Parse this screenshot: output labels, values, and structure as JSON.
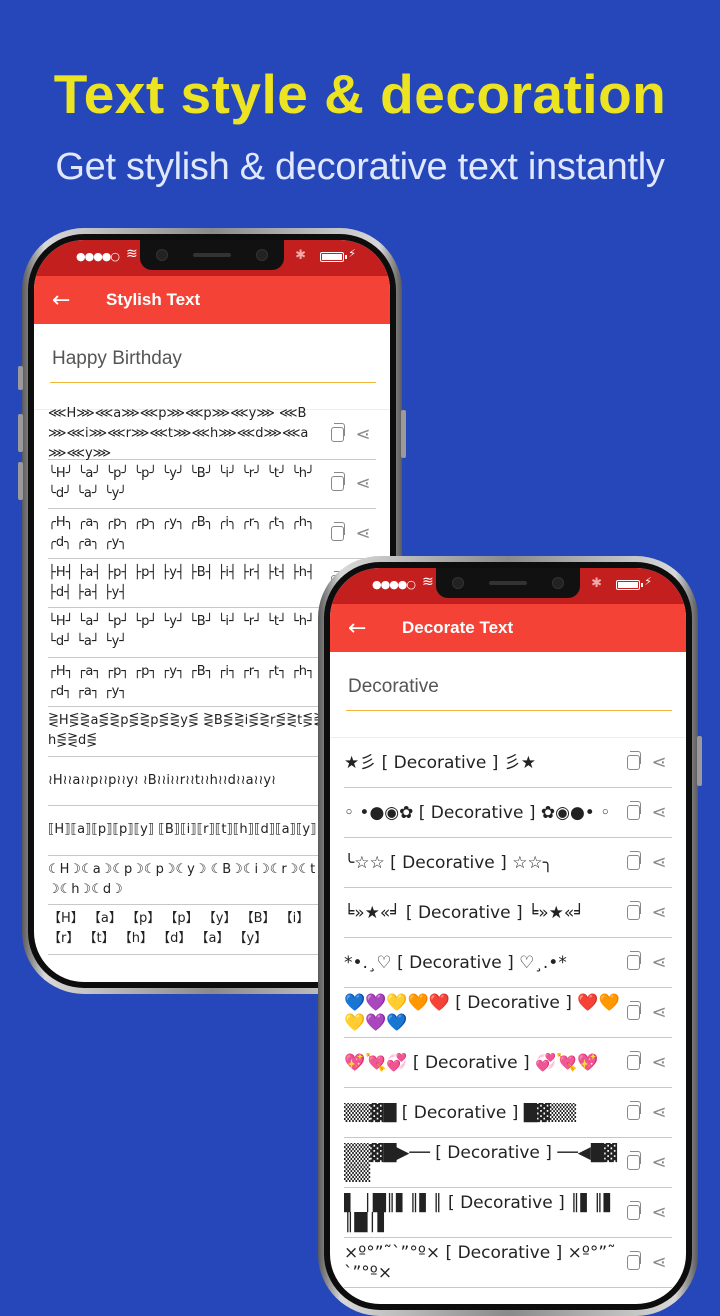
{
  "promo": {
    "headline": "Text style & decoration",
    "subheadline": "Get stylish & decorative text instantly"
  },
  "colors": {
    "background": "#2547b9",
    "headline": "#ece323",
    "appbar": "#f44336",
    "statusbar": "#c41f1f",
    "input_underline": "#f2b73a"
  },
  "status_bar": {
    "signal": "●●●●○",
    "wifi_icon": "wifi-icon",
    "bluetooth_icon": "bluetooth-icon",
    "battery_icon": "battery-icon",
    "charging_icon": "⚡"
  },
  "stylish_screen": {
    "title": "Stylish Text",
    "back_icon": "←",
    "input_value": "Happy Birthday",
    "items": [
      {
        "text": "⋘H⋙⋘a⋙⋘p⋙⋘p⋙⋘y⋙ ⋘B⋙⋘i⋙⋘r⋙⋘t⋙⋘h⋙⋘d⋙⋘a⋙⋘y⋙"
      },
      {
        "text": "╰H╯ ╰a╯ ╰p╯ ╰p╯ ╰y╯ ╰B╯ ╰i╯ ╰r╯ ╰t╯ ╰h╯ ╰d╯ ╰a╯ ╰y╯"
      },
      {
        "text": "╭H╮ ╭a╮ ╭p╮ ╭p╮ ╭y╮ ╭B╮ ╭i╮ ╭r╮ ╭t╮ ╭h╮ ╭d╮ ╭a╮ ╭y╮"
      },
      {
        "text": "├H┤ ├a┤ ├p┤ ├p┤ ├y┤ ├B┤ ├i┤ ├r┤ ├t┤ ├h┤ ├d┤ ├a┤ ├y┤"
      },
      {
        "text": "└H┘ └a┘ └p┘ └p┘ └y┘ └B┘ └i┘ └r┘ └t┘ └h┘ └d┘ └a┘ └y┘"
      },
      {
        "text": "┌H┐ ┌a┐ ┌p┐ ┌p┐ ┌y┐ ┌B┐ ┌i┐ ┌r┐ ┌t┐ ┌h┐ ┌d┐ ┌a┐ ┌y┐"
      },
      {
        "text": "⋛H⋚⋛a⋚⋛p⋚⋛p⋚⋛y⋚ ⋛B⋚⋛i⋚⋛r⋚⋛t⋚⋛h⋚⋛d⋚"
      },
      {
        "text": "≀H≀≀a≀≀p≀≀p≀≀y≀ ≀B≀≀i≀≀r≀≀t≀≀h≀≀d≀≀a≀≀y≀"
      },
      {
        "text": "⟦H⟧⟦a⟧⟦p⟧⟦p⟧⟦y⟧ ⟦B⟧⟦i⟧⟦r⟧⟦t⟧⟦h⟧⟦d⟧⟦a⟧⟦y⟧"
      },
      {
        "text": "☾H☽☾a☽☾p☽☾p☽☾y☽ ☾B☽☾i☽☾r☽☾t☽☾h☽☾d☽"
      },
      {
        "text": "【H】 【a】 【p】 【p】 【y】 【B】 【i】 【r】 【t】 【h】 【d】 【a】 【y】"
      }
    ]
  },
  "decorate_screen": {
    "title": "Decorate Text",
    "back_icon": "←",
    "input_value": "Decorative",
    "items": [
      {
        "text": "★彡 [ Decorative ] 彡★"
      },
      {
        "text": "◦ •●◉✿ [ Decorative ] ✿◉●• ◦"
      },
      {
        "text": "╰☆☆ [ Decorative ] ☆☆╮"
      },
      {
        "text": "╘»★«╛ [ Decorative ] ╘»★«╛"
      },
      {
        "text": "*•.¸♡ [ Decorative ] ♡¸.•*"
      },
      {
        "text": "💙💜💛🧡❤️ [ Decorative ] ❤️🧡💛💜💙"
      },
      {
        "text": "💖💘💞 [ Decorative ] 💞💘💖"
      },
      {
        "text": "▒▒▓█ [ Decorative ] █▓▒▒"
      },
      {
        "text": "▒▒▓█▶── [ Decorative ] ──◀█▓▒▒"
      },
      {
        "text": "▌ │█║▌║▌║ [ Decorative ] ║▌║▌║█│▌"
      },
      {
        "text": "×º°”˜`”°º× [ Decorative ] ×º°”˜`”°º×"
      }
    ]
  }
}
